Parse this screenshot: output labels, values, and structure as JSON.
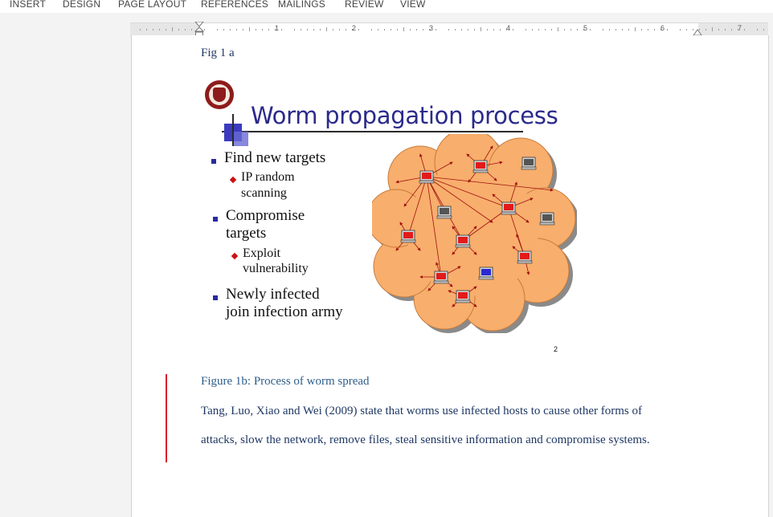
{
  "ribbon": {
    "tabs": [
      "INSERT",
      "DESIGN",
      "PAGE LAYOUT",
      "REFERENCES",
      "MAILINGS",
      "REVIEW",
      "VIEW"
    ]
  },
  "ruler": {
    "numbers": [
      "1",
      "2",
      "3",
      "4",
      "5",
      "6",
      "7"
    ]
  },
  "document": {
    "fig_label": "Fig 1 a",
    "slide": {
      "title": "Worm propagation process",
      "bullets": [
        {
          "text": "Find new targets",
          "sub": [
            "IP random",
            "scanning"
          ]
        },
        {
          "text_lines": [
            "Compromise",
            "targets"
          ],
          "sub": [
            "Exploit",
            "vulnerability"
          ]
        },
        {
          "text_lines": [
            "Newly infected",
            "join infection army"
          ]
        }
      ],
      "page_number": "2"
    },
    "caption": "Figure 1b: Process of worm spread",
    "paragraph_lines": [
      "Tang, Luo, Xiao and Wei (2009) state that worms use infected hosts to cause other forms of",
      "attacks, slow the network, remove files, steal sensitive information and compromise systems."
    ]
  },
  "colors": {
    "cloud_fill": "#f8ae6c",
    "infected_host": "#e21a1a",
    "clean_host": "#555555",
    "new_host": "#2a2ad0",
    "text_blue": "#1f3864",
    "change_bar": "#d9202a"
  }
}
